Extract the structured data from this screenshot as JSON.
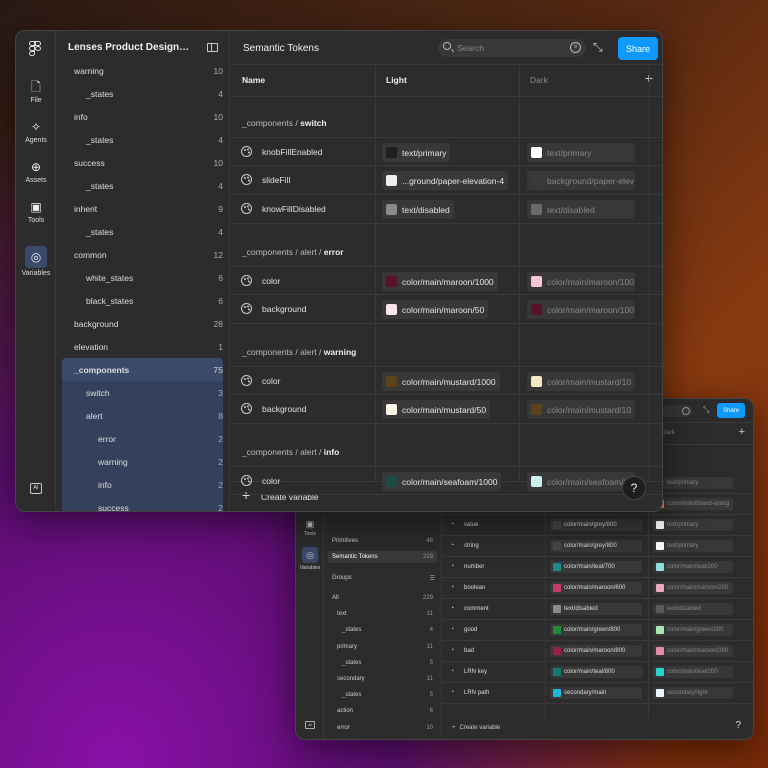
{
  "front": {
    "file_title": "Lenses Product Design System",
    "rail": [
      {
        "label": "File",
        "icon": "file-icon"
      },
      {
        "label": "Agents",
        "icon": "sparkle-icon"
      },
      {
        "label": "Assets",
        "icon": "assets-icon"
      },
      {
        "label": "Tools",
        "icon": "toolbox-icon"
      },
      {
        "label": "Variables",
        "icon": "variables-icon"
      }
    ],
    "ai_label": "AI",
    "groups": [
      {
        "label": "warning",
        "count": "10",
        "indent": 0
      },
      {
        "label": "_states",
        "count": "4",
        "indent": 1
      },
      {
        "label": "info",
        "count": "10",
        "indent": 0
      },
      {
        "label": "_states",
        "count": "4",
        "indent": 1
      },
      {
        "label": "success",
        "count": "10",
        "indent": 0
      },
      {
        "label": "_states",
        "count": "4",
        "indent": 1
      },
      {
        "label": "inherit",
        "count": "9",
        "indent": 0
      },
      {
        "label": "_states",
        "count": "4",
        "indent": 1
      },
      {
        "label": "common",
        "count": "12",
        "indent": 0
      },
      {
        "label": "white_states",
        "count": "6",
        "indent": 1
      },
      {
        "label": "black_states",
        "count": "6",
        "indent": 1
      },
      {
        "label": "background",
        "count": "28",
        "indent": 0
      },
      {
        "label": "elevation",
        "count": "1",
        "indent": 0
      },
      {
        "label": "_components",
        "count": "75",
        "indent": 0
      },
      {
        "label": "switch",
        "count": "3",
        "indent": 1
      },
      {
        "label": "alert",
        "count": "8",
        "indent": 1
      },
      {
        "label": "error",
        "count": "2",
        "indent": 2
      },
      {
        "label": "warning",
        "count": "2",
        "indent": 2
      },
      {
        "label": "info",
        "count": "2",
        "indent": 2
      },
      {
        "label": "success",
        "count": "2",
        "indent": 2
      }
    ],
    "collection_title": "Semantic Tokens",
    "search_placeholder": "Search",
    "share_label": "Share",
    "columns": {
      "name": "Name",
      "light": "Light",
      "dark": "Dark"
    },
    "sections": [
      {
        "prefix": "_components / ",
        "bold": "switch",
        "rows": [
          {
            "name": "knobFillEnabled",
            "light": "text/primary",
            "light_color": "#1e1e1e",
            "dark": "text/primary",
            "dark_color": "#ffffff"
          },
          {
            "name": "slideFill",
            "light": "...ground/paper-elevation-4",
            "light_color": "#eeeeee",
            "dark": "background/paper-elev",
            "dark_color": "#3a3a3a"
          },
          {
            "name": "knowFillDisabled",
            "light": "text/disabled",
            "light_color": "#8a8a8a",
            "dark": "text/disabled",
            "dark_color": "#6a6a6a"
          }
        ]
      },
      {
        "prefix": "_components / alert / ",
        "bold": "error",
        "rows": [
          {
            "name": "color",
            "light": "color/main/maroon/1000",
            "light_color": "#5a1228",
            "dark": "color/main/maroon/100",
            "dark_color": "#f5c6d3"
          },
          {
            "name": "background",
            "light": "color/main/maroon/50",
            "light_color": "#fbe6ec",
            "dark": "color/main/maroon/100",
            "dark_color": "#5a1228"
          }
        ]
      },
      {
        "prefix": "_components / alert / ",
        "bold": "warning",
        "rows": [
          {
            "name": "color",
            "light": "color/main/mustard/1000",
            "light_color": "#5c4318",
            "dark": "color/main/mustard/10",
            "dark_color": "#f7e9bf"
          },
          {
            "name": "background",
            "light": "color/main/mustard/50",
            "light_color": "#fdf7e6",
            "dark": "color/main/mustard/10",
            "dark_color": "#5c4318"
          }
        ]
      },
      {
        "prefix": "_components / alert / ",
        "bold": "info",
        "rows": [
          {
            "name": "color",
            "light": "color/main/seafoam/1000",
            "light_color": "#1f4a48",
            "dark": "color/main/seafoam/1",
            "dark_color": "#c9f1ee"
          }
        ]
      }
    ],
    "create_label": "Create variable",
    "help_label": "?"
  },
  "back": {
    "share_label": "Share",
    "rail": [
      {
        "label": "Tools",
        "icon": "toolbox-icon"
      },
      {
        "label": "Variables",
        "icon": "variables-icon"
      }
    ],
    "collections": [
      {
        "label": "Primitives",
        "count": "48"
      },
      {
        "label": "Semantic Tokens",
        "count": "229"
      }
    ],
    "groups_label": "Groups",
    "groups": [
      {
        "label": "All",
        "count": "229",
        "indent": 0
      },
      {
        "label": "text",
        "count": "11",
        "indent": 1
      },
      {
        "label": "_states",
        "count": "4",
        "indent": 2
      },
      {
        "label": "primary",
        "count": "11",
        "indent": 1
      },
      {
        "label": "_states",
        "count": "5",
        "indent": 2
      },
      {
        "label": "secondary",
        "count": "11",
        "indent": 1
      },
      {
        "label": "_states",
        "count": "5",
        "indent": 2
      },
      {
        "label": "action",
        "count": "6",
        "indent": 1
      },
      {
        "label": "error",
        "count": "10",
        "indent": 1
      },
      {
        "label": "_states",
        "count": "4",
        "indent": 2
      },
      {
        "label": "warning",
        "count": "10",
        "indent": 1
      }
    ],
    "dark_header": "Dark",
    "top_rows": [
      {
        "light_color": "#3a3a3a",
        "dark": "text/primary",
        "dark_color": "#3a3a3a"
      },
      {
        "light_color": "#3a3a3a",
        "dark": "color/main/brand-orang",
        "dark_color": "#f08a5d"
      }
    ],
    "rows": [
      {
        "name": "value",
        "light": "color/main/grey/800",
        "light_color": "#4a4a4a",
        "dark": "text/primary",
        "dark_color": "#ffffff"
      },
      {
        "name": "string",
        "light": "color/main/grey/800",
        "light_color": "#4a4a4a",
        "dark": "text/primary",
        "dark_color": "#ffffff"
      },
      {
        "name": "number",
        "light": "color/main/teal/700",
        "light_color": "#1a8a8a",
        "dark": "color/main/teal/200",
        "dark_color": "#8fe0e0"
      },
      {
        "name": "boolean",
        "light": "color/main/maroon/600",
        "light_color": "#c43a6a",
        "dark": "color/main/maroon/200",
        "dark_color": "#f0a8c0"
      },
      {
        "name": "comment",
        "light": "text/disabled",
        "light_color": "#8a8a8a",
        "dark": "text/disabled",
        "dark_color": "#5a5a5a"
      },
      {
        "name": "good",
        "light": "color/main/green/800",
        "light_color": "#1f8a3a",
        "dark": "color/main/green/200",
        "dark_color": "#a8e8b8"
      },
      {
        "name": "bad",
        "light": "color/main/maroon/800",
        "light_color": "#a01a4a",
        "dark": "color/main/maroon/300",
        "dark_color": "#e888a8"
      },
      {
        "name": "LRN key",
        "light": "color/main/teal/800",
        "light_color": "#0f7a7a",
        "dark": "color/main/teal/200",
        "dark_color": "#2ad0d0"
      },
      {
        "name": "LRN path",
        "light": "secondary/main",
        "light_color": "#1ab8d8",
        "dark": "secondary/light",
        "dark_color": "#e8f8ff"
      }
    ],
    "create_label": "Create variable",
    "help_label": "?"
  }
}
